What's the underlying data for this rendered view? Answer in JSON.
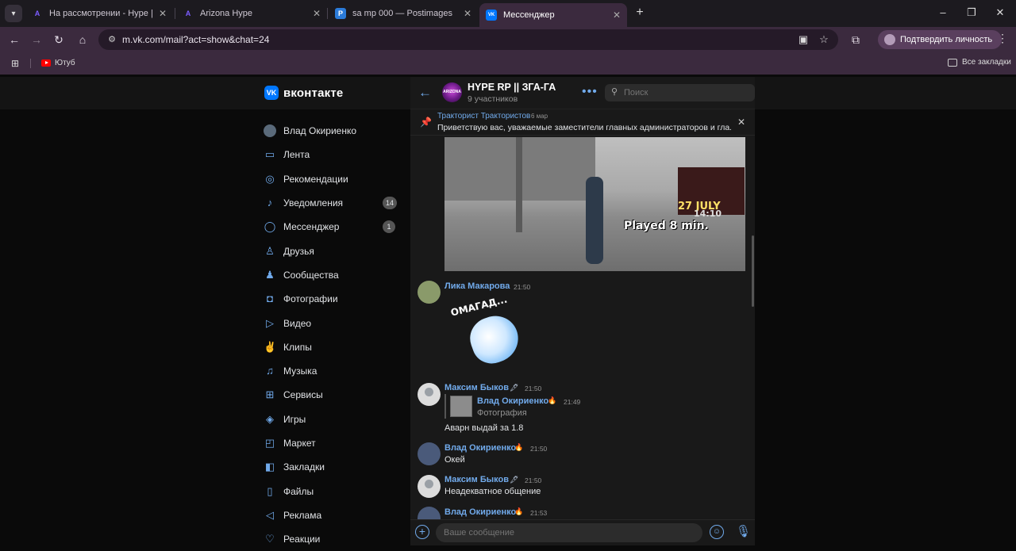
{
  "browser": {
    "tabs": [
      {
        "title": "На рассмотрении - Hype | Vla",
        "fav_color": "#7b5cff",
        "fav_glyph": "A",
        "close": "✕"
      },
      {
        "title": "Arizona Hype",
        "fav_color": "#7b5cff",
        "fav_glyph": "A",
        "close": "✕"
      },
      {
        "title": "sa mp 000 — Postimages",
        "fav_color": "#2b7bd9",
        "fav_glyph": "P",
        "close": "✕"
      },
      {
        "title": "Мессенджер",
        "fav_color": "#0077ff",
        "fav_glyph": "VK",
        "close": "✕",
        "active": true
      }
    ],
    "url": "m.vk.com/mail?act=show&chat=24",
    "profile_button": "Подтвердить личность",
    "bookmarks": {
      "youtube": "Ютуб",
      "all": "Все закладки"
    },
    "icons": {
      "back": "arrow-left-icon",
      "forward": "arrow-right-icon",
      "reload": "reload-icon",
      "home": "home-icon"
    }
  },
  "vk": {
    "logo_text": "вконтакте",
    "logo_glyph": "VK",
    "accent": "#71aaeb",
    "sidebar": [
      {
        "label": "Влад Окириенко",
        "icon": "avatar"
      },
      {
        "label": "Лента",
        "icon": "feed-icon",
        "glyph": "▭"
      },
      {
        "label": "Рекомендации",
        "icon": "compass-icon",
        "glyph": "◎"
      },
      {
        "label": "Уведомления",
        "icon": "bell-icon",
        "glyph": "♪",
        "badge": "14"
      },
      {
        "label": "Мессенджер",
        "icon": "chat-icon",
        "glyph": "◯",
        "badge": "1"
      },
      {
        "label": "Друзья",
        "icon": "user-icon",
        "glyph": "♙"
      },
      {
        "label": "Сообщества",
        "icon": "group-icon",
        "glyph": "♟"
      },
      {
        "label": "Фотографии",
        "icon": "camera-icon",
        "glyph": "◘"
      },
      {
        "label": "Видео",
        "icon": "video-icon",
        "glyph": "▷"
      },
      {
        "label": "Клипы",
        "icon": "clips-icon",
        "glyph": "✌"
      },
      {
        "label": "Музыка",
        "icon": "music-icon",
        "glyph": "♫"
      },
      {
        "label": "Сервисы",
        "icon": "services-icon",
        "glyph": "⊞"
      },
      {
        "label": "Игры",
        "icon": "gamepad-icon",
        "glyph": "◈"
      },
      {
        "label": "Маркет",
        "icon": "bag-icon",
        "glyph": "◰"
      },
      {
        "label": "Закладки",
        "icon": "bookmark-icon",
        "glyph": "◧"
      },
      {
        "label": "Файлы",
        "icon": "file-icon",
        "glyph": "▯"
      },
      {
        "label": "Реклама",
        "icon": "megaphone-icon",
        "glyph": "◁"
      },
      {
        "label": "Реакции",
        "icon": "heart-icon",
        "glyph": "♡"
      }
    ],
    "chat": {
      "title": "HYPE RP || ЗГА-ГА",
      "subtitle": "9 участников",
      "avatar_text": "ARIZONA",
      "search_placeholder": "Поиск",
      "pinned": {
        "author": "Тракторист Трактористов",
        "date": "6 мар",
        "text": "Приветствую вас, уважаемые заместители главных администраторов и гла..."
      },
      "screenshot_overlay": {
        "date": "27 JULY",
        "time": "14:10",
        "played": "Played 8 min."
      },
      "messages": [
        {
          "author": "Лика Макарова",
          "time": "21:50",
          "sticker_text": "ОМАГАД..."
        },
        {
          "author": "Максим Быков",
          "time": "21:50",
          "badge": "🖋",
          "reply_author": "Влад Окириенко",
          "reply_time": "21:49",
          "reply_badge": "🔥",
          "reply_type": "Фотография",
          "text": "Аварн выдай за 1.8"
        },
        {
          "author": "Влад Окириенко",
          "time": "21:50",
          "badge": "🔥",
          "text": "Окей"
        },
        {
          "author": "Максим Быков",
          "time": "21:50",
          "badge": "🖋",
          "text": "Неадекватное общение"
        },
        {
          "author": "Влад Окириенко",
          "time": "21:53",
          "badge": "🔥"
        }
      ],
      "composer_placeholder": "Ваше сообщение"
    }
  }
}
